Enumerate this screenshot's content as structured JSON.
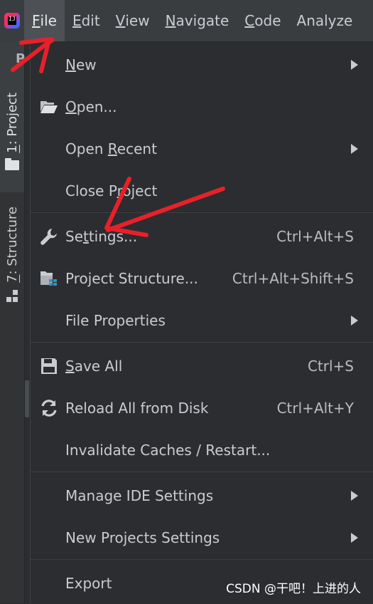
{
  "menubar": {
    "items": [
      {
        "label": "File",
        "mnemonic": "F",
        "rest": "ile"
      },
      {
        "label": "Edit",
        "mnemonic": "E",
        "rest": "dit"
      },
      {
        "label": "View",
        "mnemonic": "V",
        "rest": "iew"
      },
      {
        "label": "Navigate",
        "mnemonic": "N",
        "rest": "avigate"
      },
      {
        "label": "Code",
        "mnemonic": "C",
        "rest": "ode"
      },
      {
        "label": "Analyze",
        "mnemonic": "",
        "rest": "Analyze"
      }
    ],
    "active": "File"
  },
  "toolstrip": {
    "project_tab": {
      "mnemonic": "1",
      "rest": ": Project"
    },
    "structure_tab": {
      "mnemonic": "7",
      "rest": ": Structure"
    },
    "panel_letter": "P"
  },
  "file_menu": {
    "new": {
      "pre": "",
      "mn": "N",
      "post": "ew"
    },
    "open": {
      "pre": "",
      "mn": "O",
      "post": "pen..."
    },
    "open_recent": {
      "pre": "Open ",
      "mn": "R",
      "post": "ecent"
    },
    "close_project": {
      "pre": "Close P",
      "mn": "r",
      "post": "oject"
    },
    "settings": {
      "pre": "Se",
      "mn": "t",
      "post": "tings...",
      "shortcut": "Ctrl+Alt+S"
    },
    "project_structure": {
      "label": "Project Structure...",
      "shortcut": "Ctrl+Alt+Shift+S"
    },
    "file_properties": {
      "label": "File Properties"
    },
    "save_all": {
      "pre": "",
      "mn": "S",
      "post": "ave All",
      "shortcut": "Ctrl+S"
    },
    "reload": {
      "label": "Reload All from Disk",
      "shortcut": "Ctrl+Alt+Y"
    },
    "invalidate": {
      "label": "Invalidate Caches / Restart..."
    },
    "manage_ide": {
      "label": "Manage IDE Settings"
    },
    "new_projects": {
      "label": "New Projects Settings"
    },
    "export": {
      "label": "Export"
    }
  },
  "icons": {
    "open": "folder-open-icon",
    "settings": "wrench-icon",
    "project_structure": "project-structure-icon",
    "save_all": "save-icon",
    "reload": "reload-icon",
    "submenu": "submenu-arrow-icon"
  },
  "watermark": "CSDN @干吧！上进的人",
  "colors": {
    "menubar_bg": "#3a3d40",
    "menu_bg": "#2b2d30",
    "active_menu_bg": "#4d5155",
    "text": "#c9ccd0",
    "annotation_red": "#e8202a"
  }
}
